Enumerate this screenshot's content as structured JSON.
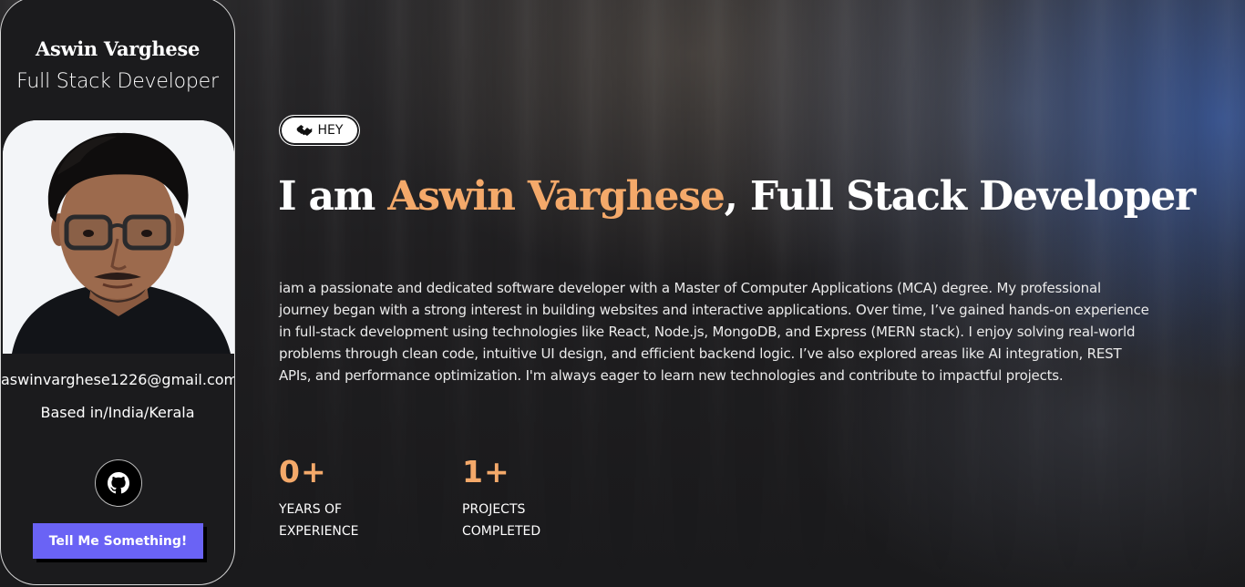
{
  "profile": {
    "name": "Aswin Varghese",
    "role": "Full Stack Developer",
    "email": "aswinvarghese1226@gmail.com",
    "location": "Based in/India/Kerala",
    "github_icon": "github-icon",
    "cta_label": "Tell Me Something!"
  },
  "hero": {
    "badge_label": "HEY",
    "badge_icon": "handshake-icon",
    "headline_prefix": "I am ",
    "headline_name": "Aswin Varghese",
    "headline_suffix": ", Full Stack Developer",
    "bio": "iam a passionate and dedicated software developer with a Master of Computer Applications (MCA) degree. My professional journey began with a strong interest in building websites and interactive applications. Over time, I’ve gained hands-on experience in full-stack development using technologies like React, Node.js, MongoDB, and Express (MERN stack). I enjoy solving real-world problems through clean code, intuitive UI design, and efficient backend logic. I’ve also explored areas like AI integration, REST APIs, and performance optimization. I'm always eager to learn new technologies and contribute to impactful projects."
  },
  "stats": [
    {
      "value": "0+",
      "label": "YEARS OF EXPERIENCE"
    },
    {
      "value": "1+",
      "label": "PROJECTS COMPLETED"
    }
  ],
  "colors": {
    "accent": "#f4a96a",
    "button": "#6a63f5",
    "card_bg": "#1b1b1d"
  }
}
